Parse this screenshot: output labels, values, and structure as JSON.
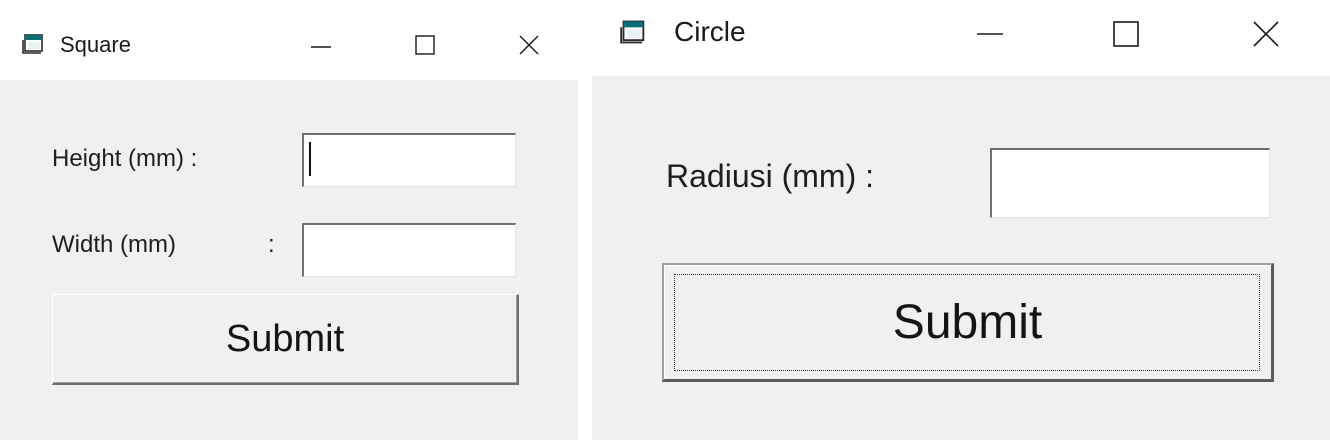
{
  "square_window": {
    "title": "Square",
    "controls": {
      "minimize_glyph": "—",
      "maximize_glyph": "☐",
      "close_glyph": "✕"
    },
    "height_label": "Height (mm) :",
    "height_value": "",
    "width_label": "Width (mm)",
    "width_colon": ":",
    "width_value": "",
    "submit_label": "Submit"
  },
  "circle_window": {
    "title": "Circle",
    "controls": {
      "minimize_glyph": "—",
      "maximize_glyph": "☐",
      "close_glyph": "✕"
    },
    "radius_label": "Radiusi (mm) :",
    "radius_value": "",
    "submit_label": "Submit"
  },
  "colors": {
    "window_background": "#f0f0f0",
    "titlebar_background": "#ffffff",
    "icon_teal": "#0b6e75",
    "text": "#1e1e1e"
  },
  "icons": {
    "window_icon": "application-window-icon",
    "minimize": "minimize-icon",
    "maximize": "maximize-icon",
    "close": "close-icon"
  }
}
